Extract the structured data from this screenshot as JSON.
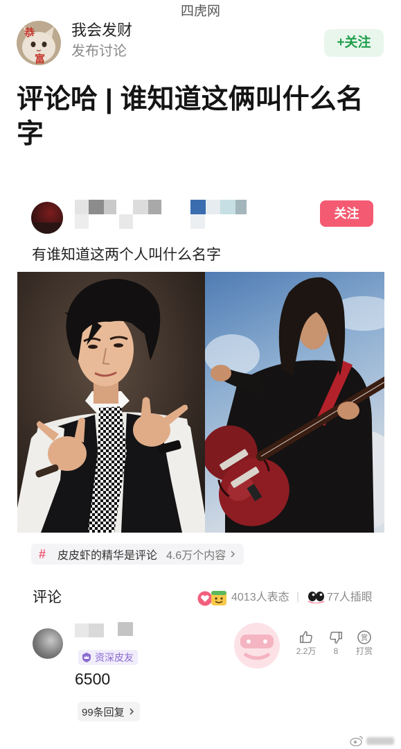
{
  "watermark": "四虎网",
  "colors": {
    "follow_green": "#1f9e4a",
    "follow_green_bg": "#e8f6ec",
    "follow_pink": "#f45b72",
    "topic_hash": "#ef5f79",
    "badge_purple": "#8a6bcf",
    "muted_text": "#8b8b8b"
  },
  "icons": {
    "avatar": "lucky-cat-avatar",
    "reactions": [
      "heart-reaction-icon",
      "grin-emoji-icon"
    ],
    "watch": "eyes-icon",
    "badge": "crown-shield-icon",
    "like": "thumbs-up-icon",
    "dislike": "thumbs-down-icon",
    "reward": "reward-coin-icon",
    "chevron": "chevron-right-icon",
    "watermark_logo": "weibo-icon"
  },
  "author": {
    "avatar_lettering": [
      "恭",
      "富"
    ],
    "name": "我会发财",
    "action": "发布讨论",
    "follow_label": "+关注"
  },
  "post_title": "评论哈 | 谁知道这俩叫什么名字",
  "shared_post": {
    "follow_label": "关注",
    "text": "有谁知道这两个人叫什么名字",
    "topic": {
      "hash": "#",
      "name": "皮皮虾的精华是评论",
      "count": "4.6万个内容"
    }
  },
  "comments": {
    "heading": "评论",
    "reaction_count": "4013人表态",
    "divider": "|",
    "watch_count": "77人插眼",
    "top_comment": {
      "badge": "资深皮友",
      "text": "6500",
      "replies": "99条回复",
      "likes": "2.2万",
      "dislikes": "8",
      "reward_label": "打赏",
      "reward_glyph": "赏"
    }
  }
}
